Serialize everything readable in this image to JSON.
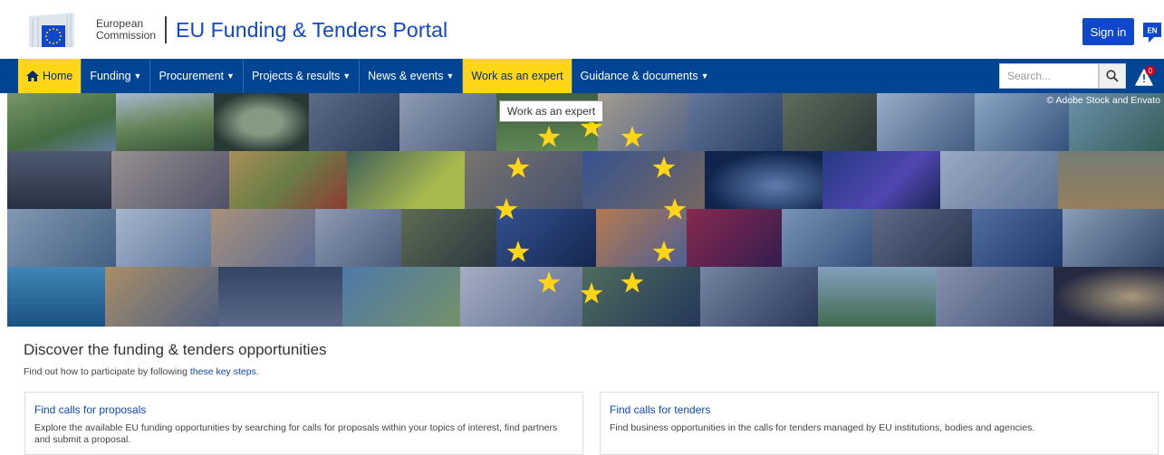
{
  "header": {
    "logo_line1": "European",
    "logo_line2": "Commission",
    "portal_title": "EU Funding & Tenders Portal",
    "signin_label": "Sign in",
    "lang_label": "EN",
    "brand_color": "#0e47cb"
  },
  "nav": {
    "items": [
      {
        "label": "Home",
        "icon": "home-icon",
        "active": true
      },
      {
        "label": "Funding",
        "caret": true
      },
      {
        "label": "Procurement",
        "caret": true
      },
      {
        "label": "Projects & results",
        "caret": true
      },
      {
        "label": "News & events",
        "caret": true
      },
      {
        "label": "Work as an expert",
        "active": true
      },
      {
        "label": "Guidance & documents",
        "caret": true
      }
    ],
    "search_placeholder": "Search...",
    "notification_count": "0",
    "bar_color": "#004494",
    "active_color": "#ffd617"
  },
  "hero": {
    "copyright": "© Adobe Stock and Envato",
    "tooltip": "Work as an expert"
  },
  "discover": {
    "title": "Discover the funding & tenders opportunities",
    "sub_prefix": "Find out how to participate by following ",
    "sub_link": "these key steps",
    "sub_suffix": "."
  },
  "cards": [
    {
      "title": "Find calls for proposals",
      "text": "Explore the available EU funding opportunities by searching for calls for proposals within your topics of interest, find partners and submit a proposal."
    },
    {
      "title": "Find calls for tenders",
      "text": "Find business opportunities in the calls for tenders managed by EU institutions, bodies and agencies."
    }
  ]
}
